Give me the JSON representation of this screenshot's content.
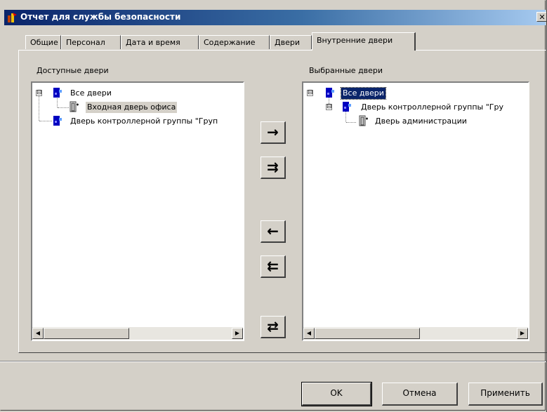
{
  "window": {
    "title": "Отчет для службы безопасности",
    "close_symbol": "✕",
    "colors": {
      "titlebar": "#0a246a",
      "face": "#d4d0c8"
    }
  },
  "tabs": [
    {
      "label": "Общие"
    },
    {
      "label": "Персонал"
    },
    {
      "label": "Дата и время"
    },
    {
      "label": "Содержание"
    },
    {
      "label": "Двери"
    },
    {
      "label": "Внутренние двери",
      "active": true
    }
  ],
  "available": {
    "label": "Доступные двери",
    "tree": [
      {
        "label": "Все двери",
        "icon": "door-group-icon",
        "expander": "⊟"
      },
      {
        "label": "Входная дверь офиса",
        "icon": "door-icon"
      },
      {
        "label": "Дверь контроллерной группы \"Груп",
        "icon": "door-group-icon"
      }
    ]
  },
  "selected": {
    "label": "Выбранные двери",
    "tree": [
      {
        "label": "Все двери",
        "icon": "door-group-icon",
        "expander": "⊟"
      },
      {
        "label": "Дверь контроллерной группы \"Гру",
        "icon": "door-group-icon",
        "expander": "⊟"
      },
      {
        "label": "Дверь администрации",
        "icon": "door-icon"
      }
    ]
  },
  "transfer_buttons": {
    "add": "→",
    "add_all": "⇉",
    "remove": "←",
    "remove_all": "⇇",
    "swap": "⇄"
  },
  "scrollbar": {
    "left_arrow": "◀",
    "right_arrow": "▶"
  },
  "buttons": {
    "ok": "OK",
    "cancel": "Отмена",
    "apply": "Применить"
  }
}
